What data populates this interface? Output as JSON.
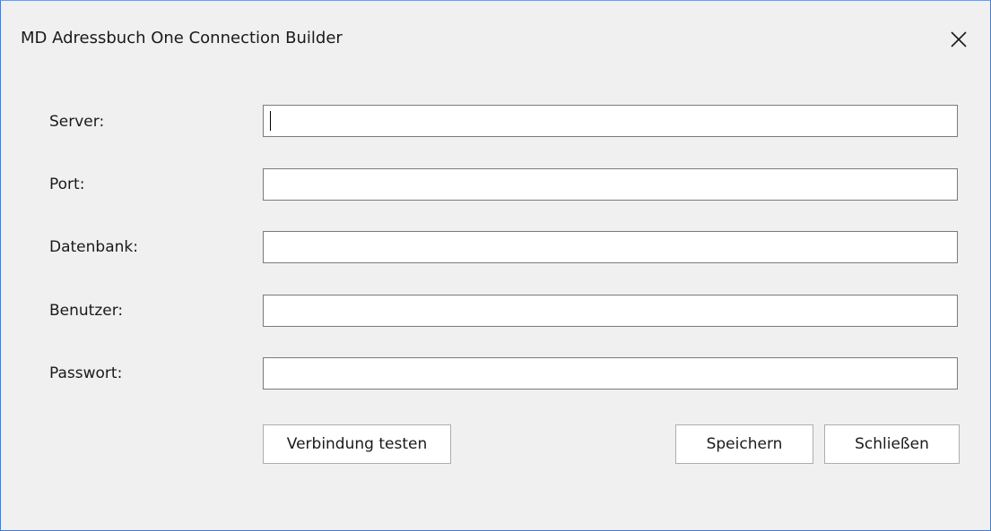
{
  "window": {
    "title": "MD Adressbuch One Connection Builder"
  },
  "form": {
    "fields": [
      {
        "label": "Server:",
        "value": ""
      },
      {
        "label": "Port:",
        "value": ""
      },
      {
        "label": "Datenbank:",
        "value": ""
      },
      {
        "label": "Benutzer:",
        "value": ""
      },
      {
        "label": "Passwort:",
        "value": ""
      }
    ]
  },
  "buttons": {
    "test_label": "Verbindung testen",
    "save_label": "Speichern",
    "close_label": "Schließen"
  },
  "icons": {
    "close": "close-icon"
  },
  "colors": {
    "window_bg": "#f0f0f0",
    "border_accent": "#4a7cc4",
    "input_border": "#7a7a7a",
    "button_border": "#adadad"
  }
}
